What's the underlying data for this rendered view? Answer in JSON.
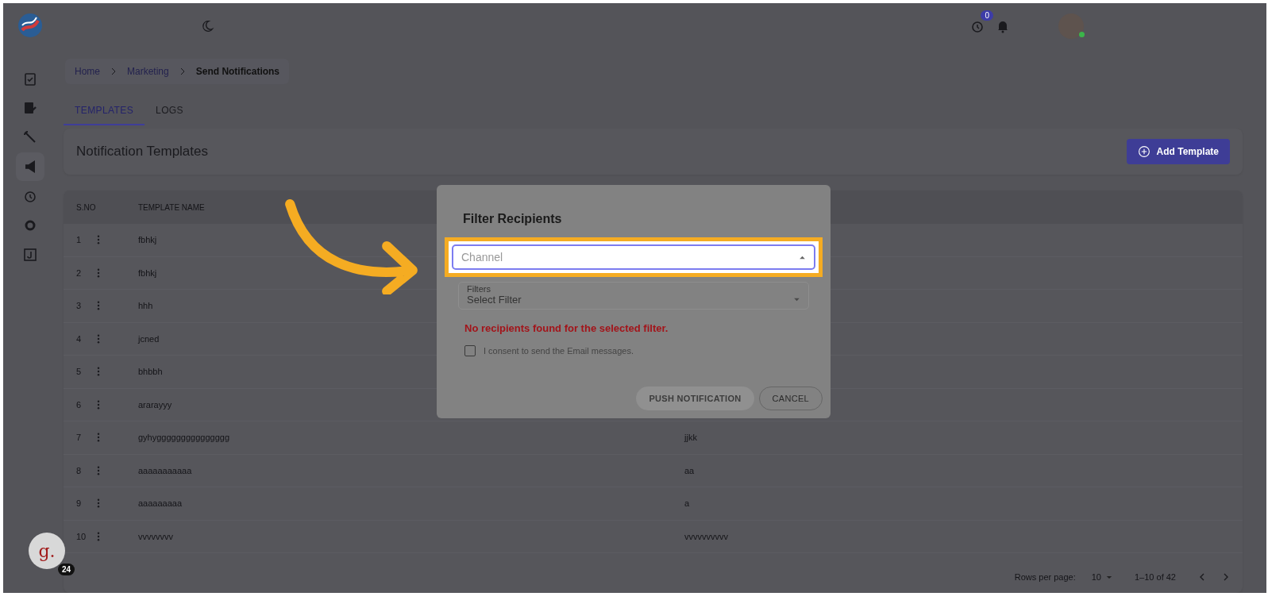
{
  "topbar": {
    "timer_badge": "0"
  },
  "breadcrumb": [
    {
      "label": "Home",
      "current": false
    },
    {
      "label": "Marketing",
      "current": false
    },
    {
      "label": "Send Notifications",
      "current": true
    }
  ],
  "tabs": [
    {
      "label": "TEMPLATES",
      "selected": true
    },
    {
      "label": "LOGS",
      "selected": false
    }
  ],
  "header": {
    "title": "Notification Templates",
    "add_button": "Add Template"
  },
  "table": {
    "columns": [
      "S.NO",
      "TEMPLATE NAME"
    ],
    "rows": [
      {
        "sno": "1",
        "name": "fbhkj"
      },
      {
        "sno": "2",
        "name": "fbhkj"
      },
      {
        "sno": "3",
        "name": "hhh"
      },
      {
        "sno": "4",
        "name": "jcned"
      },
      {
        "sno": "5",
        "name": "bhbbh"
      },
      {
        "sno": "6",
        "name": "ararayyy"
      },
      {
        "sno": "7",
        "name": "gyhyggggggggggggggg",
        "column_3": "jjkk"
      },
      {
        "sno": "8",
        "name": "aaaaaaaaaaa",
        "column_3": "aa"
      },
      {
        "sno": "9",
        "name": "aaaaaaaaa",
        "column_3": "a"
      },
      {
        "sno": "10",
        "name": "vvvvvvvv",
        "column_3": "vvvvvvvvvv"
      }
    ]
  },
  "pagination": {
    "rows_per_page_label": "Rows per page:",
    "rows_per_page": "10",
    "range": "1–10 of 42"
  },
  "chat_widget": {
    "letter": "g.",
    "badge": "24"
  },
  "dialog": {
    "title": "Filter Recipients",
    "channel_field": {
      "placeholder": "Channel",
      "expanded": true,
      "highlighted": true
    },
    "filters_field": {
      "label": "Filters",
      "placeholder": "Select Filter",
      "disabled": true
    },
    "error": "No recipients found for the selected filter.",
    "consent": {
      "label": "I consent to send the Email messages.",
      "checked": false
    },
    "buttons": [
      {
        "label": "PUSH NOTIFICATION",
        "disabled": true
      },
      {
        "label": "CANCEL",
        "disabled": false
      }
    ]
  }
}
